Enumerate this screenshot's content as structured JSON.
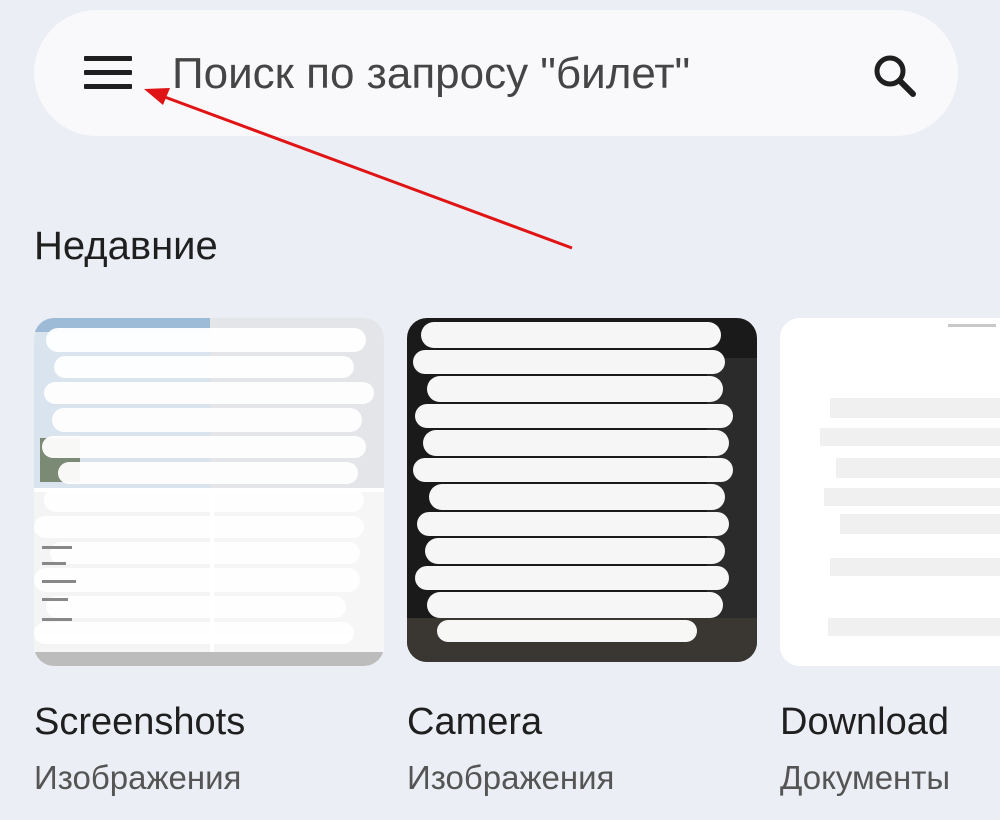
{
  "search": {
    "placeholder": "Поиск по запросу \"билет\""
  },
  "recent": {
    "title": "Недавние",
    "folders": [
      {
        "name": "Screenshots",
        "kind": "Изображения"
      },
      {
        "name": "Camera",
        "kind": "Изображения"
      },
      {
        "name": "Download",
        "kind": "Документы"
      }
    ]
  },
  "icons": {
    "menu": "menu-icon",
    "search": "search-icon",
    "annotation": "red-arrow"
  },
  "colors": {
    "background": "#eceef6",
    "search_bar": "#f9f9fc",
    "annotation_arrow": "#e01414"
  }
}
